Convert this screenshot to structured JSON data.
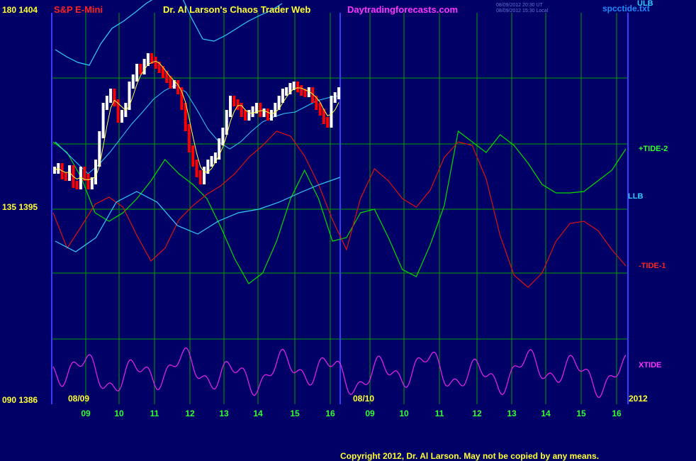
{
  "header": {
    "symbol": "S&P E-Mini",
    "title": "Dr. Al Larson's Chaos Trader Web",
    "site": "Daytradingforecasts.com",
    "ts1": "08/09/2012 20:30 UT",
    "ts2": "08/09/2012 15:30 Local",
    "file": "spcctide.txt"
  },
  "left_scale": [
    {
      "text": "180  1404"
    },
    {
      "text": "135  1395"
    },
    {
      "text": "090  1386"
    }
  ],
  "right_labels": {
    "ulb": "ULB",
    "tide2": "+TIDE-2",
    "llb": "LLB",
    "tide1": "-TIDE-1",
    "xtide": "XTIDE",
    "year": "2012"
  },
  "date_labels": {
    "d1": "08/09",
    "d2": "08/10"
  },
  "copyright": "Copyright 2012, Dr. Al Larson. May not be copied by any means.",
  "colors": {
    "background": "#000066",
    "grid": "#00a000",
    "frame": "#3b3bff",
    "tide2": "#00dd00",
    "tide1": "#dd1111",
    "band": "#33ccff",
    "xtide": "#ee22ee",
    "avg": "#ffff44",
    "up_bar": "#ffffff",
    "down_bar": "#ff0000"
  },
  "chart_data": {
    "type": "line",
    "x_ticks": [
      "09",
      "10",
      "11",
      "12",
      "13",
      "14",
      "15",
      "16",
      "09",
      "10",
      "11",
      "12",
      "13",
      "14",
      "15",
      "16"
    ],
    "y_ticks": [
      "1404",
      "1395",
      "1386"
    ],
    "series": [
      {
        "name": "+TIDE-2",
        "values": [
          200,
          215,
          250,
          300,
          312,
          300,
          280,
          255,
          225,
          245,
          260,
          280,
          320,
          365,
          400,
          385,
          340,
          280,
          240,
          280,
          340,
          335,
          300,
          295,
          335,
          380,
          390,
          345,
          290,
          185,
          200,
          215,
          190,
          205,
          230,
          260,
          272,
          272,
          270,
          255,
          240,
          210
        ]
      },
      {
        "name": "-TIDE-1",
        "values": [
          300,
          350,
          320,
          288,
          278,
          292,
          332,
          368,
          350,
          310,
          290,
          274,
          262,
          245,
          222,
          205,
          185,
          192,
          220,
          260,
          310,
          352,
          280,
          238,
          255,
          280,
          292,
          268,
          222,
          200,
          205,
          252,
          332,
          388,
          405,
          385,
          340,
          315,
          312,
          325,
          352,
          375
        ]
      },
      {
        "name": "ULB",
        "values": [
          70,
          80,
          88,
          92,
          62,
          40,
          30,
          18,
          5,
          -5,
          -10,
          -10,
          25,
          55,
          58,
          50,
          40,
          30,
          22,
          15,
          5
        ]
      },
      {
        "name": "LLB",
        "values": [
          340,
          355,
          335,
          285,
          270,
          285,
          318,
          330,
          312,
          300,
          295,
          285,
          272,
          260,
          250
        ]
      }
    ]
  }
}
